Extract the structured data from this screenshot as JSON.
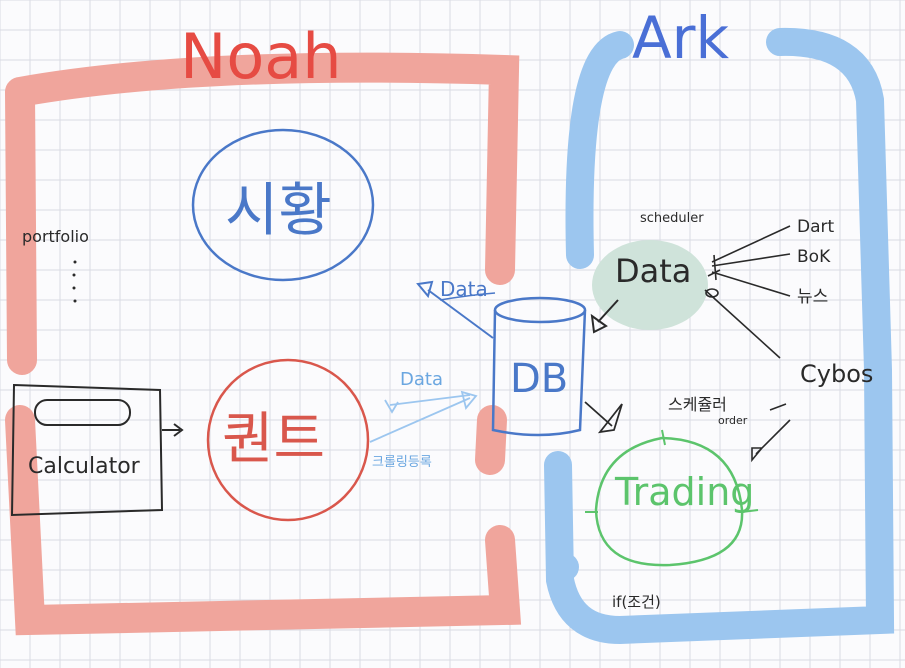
{
  "colors": {
    "grid": "#d9dbe3",
    "noah": "#f0a59c",
    "noah_text": "#e64b43",
    "ark": "#9cc6ef",
    "ark_text": "#4a6fd6",
    "blue_ink": "#4a78c8",
    "red_ink": "#d9574c",
    "green": "#5cc46c",
    "teal_blob": "#cfe3da",
    "black": "#2a2a2a"
  },
  "titles": {
    "noah": "Noah",
    "ark": "Ark"
  },
  "noah": {
    "market": "시황",
    "quant": "퀀트",
    "portfolio": "portfolio",
    "calculator": "Calculator",
    "data_top": "Data",
    "data_mid": "Data",
    "cross_label": "크롤링등록"
  },
  "db": "DB",
  "ark": {
    "scheduler": "scheduler",
    "data": "Data",
    "sources": [
      "Dart",
      "BoK",
      "뉴스",
      "Cybos"
    ],
    "scheduler_order": "스케쥴러",
    "order": "order",
    "trading": "Trading",
    "condition": "if(조건)"
  }
}
